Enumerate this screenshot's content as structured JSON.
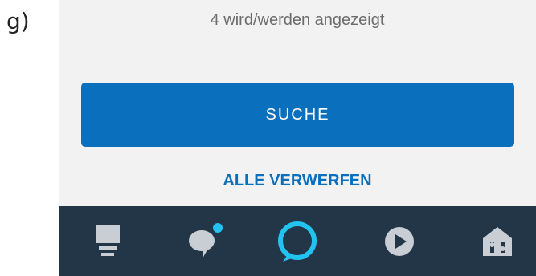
{
  "figure_label": "g)",
  "results": {
    "count_text": "4 wird/werden angezeigt"
  },
  "actions": {
    "search_label": "SUCHE",
    "discard_all_label": "ALLE VERWERFEN"
  },
  "bottom_nav": {
    "items": [
      {
        "icon": "home-icon"
      },
      {
        "icon": "communicate-icon",
        "notification_dot": true
      },
      {
        "icon": "alexa-icon"
      },
      {
        "icon": "play-icon"
      },
      {
        "icon": "devices-icon"
      }
    ]
  },
  "colors": {
    "accent": "#0a6fbd",
    "nav_background": "#233648",
    "alexa_ring": "#22c3f0",
    "nav_icon": "#c9ced4",
    "page_background": "#f2f2f2"
  }
}
